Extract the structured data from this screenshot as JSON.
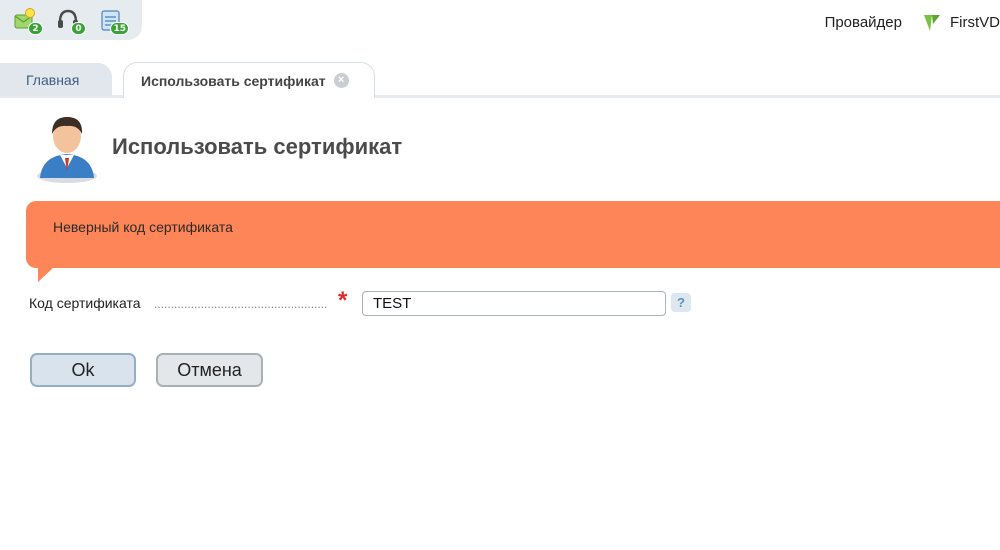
{
  "toolbar": {
    "icons": [
      {
        "name": "notifications-icon",
        "badge": "2"
      },
      {
        "name": "support-icon",
        "badge": "0"
      },
      {
        "name": "tasks-icon",
        "badge": "15"
      }
    ]
  },
  "header": {
    "provider_label": "Провайдер",
    "brand_label": "FirstVD"
  },
  "tabs": [
    {
      "label": "Главная",
      "active": false
    },
    {
      "label": "Использовать сертификат",
      "active": true
    }
  ],
  "page": {
    "title": "Использовать сертификат"
  },
  "error": {
    "message": "Неверный код сертификата"
  },
  "form": {
    "field_label": "Код сертификата",
    "required_mark": "*",
    "value": "TEST",
    "help_glyph": "?"
  },
  "buttons": {
    "ok_label": "Ok",
    "cancel_label": "Отмена"
  },
  "colors": {
    "error_bg": "#fe8558",
    "badge_green": "#3aa335",
    "toolbar_bg": "#e6ebef",
    "brand_green": "#7ac142"
  }
}
